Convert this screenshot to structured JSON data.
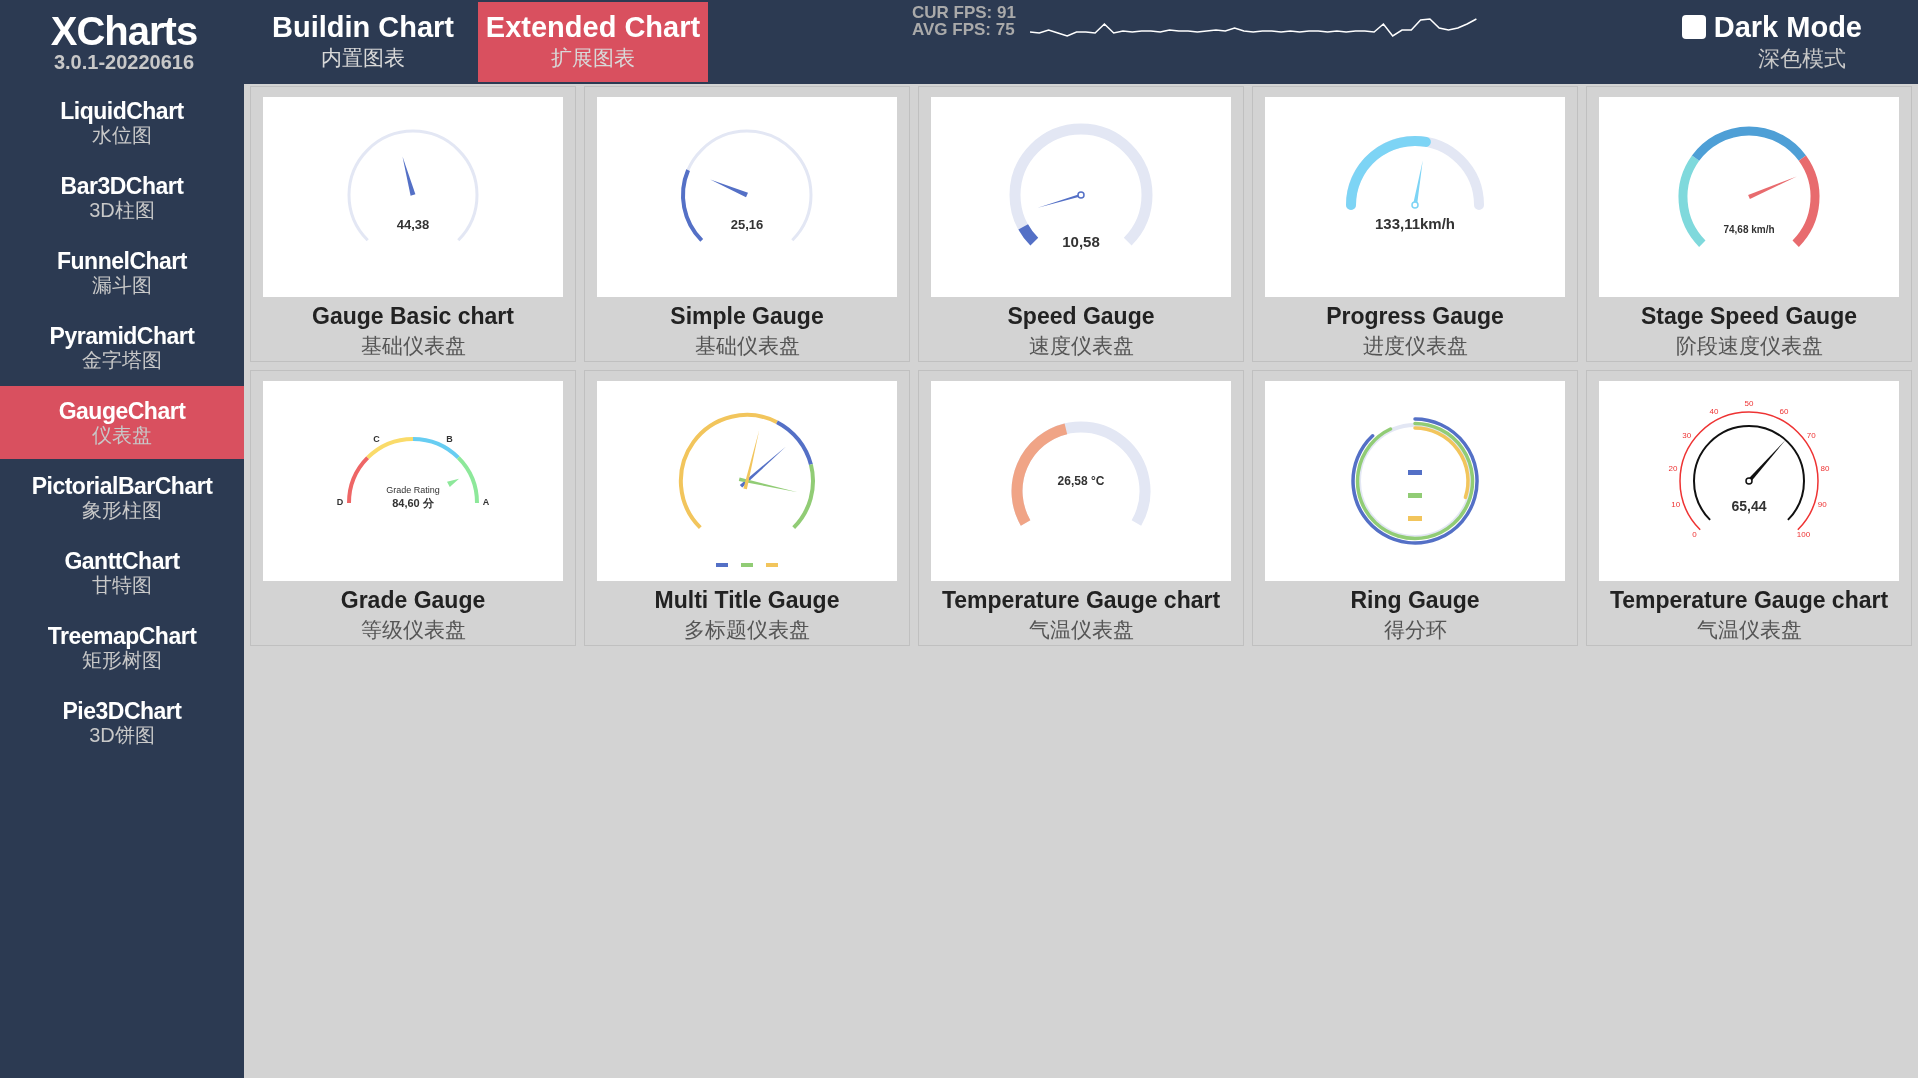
{
  "app": {
    "name": "XCharts",
    "version": "3.0.1-20220616"
  },
  "tabs": [
    {
      "label": "Buildin Chart",
      "sublabel": "内置图表",
      "selected": false
    },
    {
      "label": "Extended Chart",
      "sublabel": "扩展图表",
      "selected": true
    }
  ],
  "fps": {
    "current": "CUR FPS: 91",
    "average": "AVG FPS: 75"
  },
  "dark_mode": {
    "label": "Dark Mode",
    "sublabel": "深色模式",
    "checked": false
  },
  "sidebar": {
    "items": [
      {
        "label": "LiquidChart",
        "sublabel": "水位图",
        "selected": false
      },
      {
        "label": "Bar3DChart",
        "sublabel": "3D柱图",
        "selected": false
      },
      {
        "label": "FunnelChart",
        "sublabel": "漏斗图",
        "selected": false
      },
      {
        "label": "PyramidChart",
        "sublabel": "金字塔图",
        "selected": false
      },
      {
        "label": "GaugeChart",
        "sublabel": "仪表盘",
        "selected": true
      },
      {
        "label": "PictorialBarChart",
        "sublabel": "象形柱图",
        "selected": false
      },
      {
        "label": "GanttChart",
        "sublabel": "甘特图",
        "selected": false
      },
      {
        "label": "TreemapChart",
        "sublabel": "矩形树图",
        "selected": false
      },
      {
        "label": "Pie3DChart",
        "sublabel": "3D饼图",
        "selected": false
      }
    ]
  },
  "gauges": [
    {
      "kind": "basic",
      "value": "44,38",
      "title": "Gauge Basic chart",
      "subtitle": "基础仪表盘"
    },
    {
      "kind": "simple",
      "value": "25,16",
      "title": "Simple Gauge",
      "subtitle": "基础仪表盘"
    },
    {
      "kind": "speed",
      "value": "10,58",
      "title": "Speed Gauge",
      "subtitle": "速度仪表盘"
    },
    {
      "kind": "progress",
      "value": "133,11km/h",
      "title": "Progress Gauge",
      "subtitle": "进度仪表盘"
    },
    {
      "kind": "stage",
      "value": "74,68 km/h",
      "title": "Stage Speed Gauge",
      "subtitle": "阶段速度仪表盘"
    },
    {
      "kind": "grade",
      "label": "Grade Rating",
      "value": "84,60 分",
      "ticks": [
        "D",
        "C",
        "B",
        "A"
      ],
      "title": "Grade Gauge",
      "subtitle": "等级仪表盘"
    },
    {
      "kind": "multi",
      "title": "Multi Title Gauge",
      "subtitle": "多标题仪表盘"
    },
    {
      "kind": "temperature",
      "value": "26,58 °C",
      "title": "Temperature Gauge chart",
      "subtitle": "气温仪表盘"
    },
    {
      "kind": "ring",
      "title": "Ring Gauge",
      "subtitle": "得分环"
    },
    {
      "kind": "thermo",
      "value": "65,44",
      "ticks": [
        "0",
        "10",
        "20",
        "30",
        "40",
        "50",
        "60",
        "70",
        "80",
        "90",
        "100"
      ],
      "title": "Temperature Gauge chart",
      "subtitle": "气温仪表盘"
    }
  ]
}
